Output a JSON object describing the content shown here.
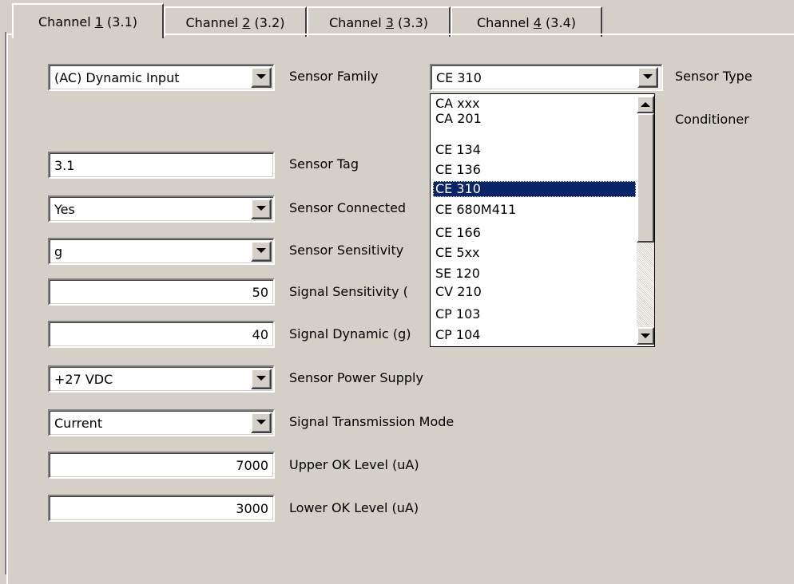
{
  "tabs": [
    {
      "label_prefix": "Channel ",
      "label_mnemonic": "1",
      "label_suffix": " (3.1)"
    },
    {
      "label_prefix": "Channel ",
      "label_mnemonic": "2",
      "label_suffix": " (3.2)"
    },
    {
      "label_prefix": "Channel ",
      "label_mnemonic": "3",
      "label_suffix": " (3.3)"
    },
    {
      "label_prefix": "Channel ",
      "label_mnemonic": "4",
      "label_suffix": " (3.4)"
    }
  ],
  "form": {
    "input_type": {
      "value": "(AC) Dynamic Input"
    },
    "sensor_family": {
      "label": "Sensor Family",
      "value": "CE 310"
    },
    "sensor_type": {
      "label": "Sensor Type"
    },
    "conditioner": {
      "label": "Conditioner"
    },
    "sensor_tag": {
      "label": "Sensor Tag",
      "value": "3.1"
    },
    "sensor_connected": {
      "label": "Sensor Connected",
      "value": "Yes"
    },
    "sensor_sensitivity": {
      "label": "Sensor Sensitivity",
      "value": "g"
    },
    "signal_sensitivity": {
      "label": "Signal Sensitivity (",
      "value": "50"
    },
    "signal_dynamic": {
      "label": "Signal Dynamic (g)",
      "value": "40"
    },
    "sensor_power_supply": {
      "label": "Sensor Power Supply",
      "value": "+27 VDC"
    },
    "signal_transmission_mode": {
      "label": "Signal Transmission Mode",
      "value": "Current"
    },
    "upper_ok_level": {
      "label": "Upper OK Level (uA)",
      "value": "7000"
    },
    "lower_ok_level": {
      "label": "Lower OK Level (uA)",
      "value": "3000"
    }
  },
  "sensor_family_dropdown": {
    "options": [
      "CA xxx",
      "CA 201",
      "CE 134",
      "CE 136",
      "CE 310",
      "CE 680M411",
      "CE 166",
      "CE 5xx",
      "SE 120",
      "CV 210",
      "CP 103",
      "CP 104"
    ],
    "selected": "CE 310"
  },
  "colors": {
    "face": "#d4d0c8",
    "highlight": "#0a246a"
  },
  "icons": {
    "dropdown": "chevron-down-icon",
    "scroll_up": "arrow-up-icon",
    "scroll_down": "arrow-down-icon"
  }
}
